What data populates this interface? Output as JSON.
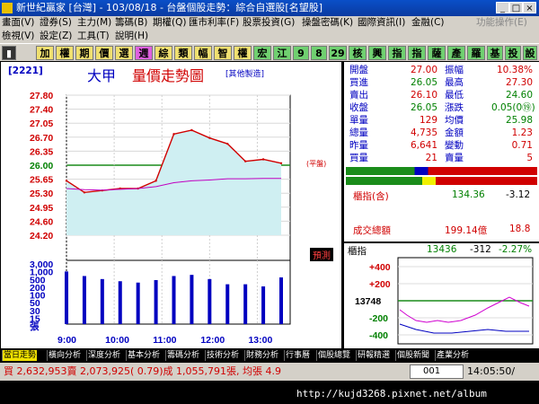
{
  "window": {
    "title": "新世紀贏家 [台灣] - 103/08/18 - 台盤個股走勢：綜合自選股[名望股]"
  },
  "menu1": [
    "畫面(V)",
    "證券(S)",
    "主力(M)",
    "籌碼(B)",
    "期權(Q)",
    "匯市利率(F)",
    "股票投資(G)",
    "操盤密碼(K)",
    "國際資訊(I)",
    "金融(C)",
    "功能操作(E)"
  ],
  "menu2": [
    "檢視(V)",
    "設定(Z)",
    "工具(T)",
    "說明(H)"
  ],
  "toolbar": [
    "加",
    "權",
    "期",
    "價",
    "選",
    "週",
    "綜",
    "類",
    "幅",
    "智",
    "權",
    "宏",
    "江",
    "9",
    "8",
    "29",
    "核",
    "興",
    "指",
    "指",
    "薩",
    "產",
    "羅",
    "基",
    "投",
    "設",
    "網"
  ],
  "chart": {
    "code": "[2221]",
    "name": "大甲",
    "title": "量價走勢圖",
    "note": "[其他製造]",
    "price_ticks": [
      "27.80",
      "27.40",
      "27.05",
      "26.70",
      "26.35",
      "26.00",
      "25.65",
      "25.30",
      "24.95",
      "24.60",
      "24.20"
    ],
    "volume_ticks": [
      "3,000",
      "1,000",
      "500",
      "200",
      "100",
      "50",
      "30",
      "15",
      "張"
    ],
    "time_ticks": [
      "9:00",
      "10:00",
      "11:00",
      "12:00",
      "13:00"
    ],
    "ref_label": "(平盤)",
    "predict_label": "預測"
  },
  "chart_data": {
    "type": "line",
    "x": [
      "9:00",
      "9:30",
      "10:00",
      "10:30",
      "11:00",
      "11:30",
      "12:00",
      "12:15",
      "12:30",
      "12:45",
      "13:00",
      "13:15",
      "13:30"
    ],
    "series": [
      {
        "name": "價",
        "values": [
          25.6,
          25.3,
          25.35,
          25.4,
          25.4,
          25.6,
          26.8,
          26.9,
          26.7,
          26.55,
          26.1,
          26.15,
          26.05
        ]
      },
      {
        "name": "均價",
        "values": [
          25.4,
          25.37,
          25.36,
          25.38,
          25.4,
          25.45,
          25.55,
          25.6,
          25.62,
          25.65,
          25.65,
          25.66,
          25.66
        ]
      }
    ],
    "volume": [
      1100,
      600,
      400,
      300,
      250,
      350,
      600,
      700,
      400,
      200,
      200,
      150,
      500
    ],
    "ylim": [
      24.2,
      27.8
    ],
    "reference": 26.0
  },
  "quote": {
    "rows": [
      {
        "k1": "開盤",
        "v1": "27.00",
        "k2": "振幅",
        "v2": "10.38%",
        "c1": "#d00000",
        "c2": "#d00000"
      },
      {
        "k1": "買進",
        "v1": "26.05",
        "k2": "最高",
        "v2": "27.30",
        "c1": "#008000",
        "c2": "#d00000"
      },
      {
        "k1": "賣出",
        "v1": "26.10",
        "k2": "最低",
        "v2": "24.60",
        "c1": "#d00000",
        "c2": "#008000"
      },
      {
        "k1": "收盤",
        "v1": "26.05",
        "k2": "漲跌",
        "v2": "0.05(0⑲)",
        "c1": "#008000",
        "c2": "#008000"
      },
      {
        "k1": "單量",
        "v1": "129",
        "k2": "均價",
        "v2": "25.98",
        "c1": "#d00000",
        "c2": "#008000"
      },
      {
        "k1": "總量",
        "v1": "4,735",
        "k2": "金額",
        "v2": "1.23",
        "c1": "#d00000",
        "c2": "#d00000"
      },
      {
        "k1": "昨量",
        "v1": "6,641",
        "k2": "變動",
        "v2": "0.71",
        "c1": "#d00000",
        "c2": "#d00000"
      },
      {
        "k1": "買量",
        "v1": "21",
        "k2": "賣量",
        "v2": "5",
        "c1": "#d00000",
        "c2": "#d00000"
      }
    ],
    "index_label": "櫃指(含)",
    "index_value": "134.36",
    "index_change": "-3.12",
    "turnover_label": "成交總額",
    "turnover_value": "199.14億",
    "turnover_extra": "18.8"
  },
  "mini": {
    "label": "櫃指",
    "value": "13436",
    "change": "-312",
    "pct": "-2.27%",
    "ticks": [
      "+400",
      "+200",
      "13748",
      "-200",
      "-400"
    ]
  },
  "tabs": [
    "當日走勢",
    "橫向分析",
    "深度分析",
    "基本分析",
    "籌碼分析",
    "技術分析",
    "財務分析",
    "行事曆",
    "個股總覽",
    "研報精選",
    "個股新聞",
    "產業分析"
  ],
  "status": {
    "summary": "買 2,632,953賣 2,073,925( 0.79)成 1,055,791張, 均張 4.9",
    "code": "001",
    "time": "14:05:50/"
  },
  "url": "http://kujd3268.pixnet.net/album"
}
